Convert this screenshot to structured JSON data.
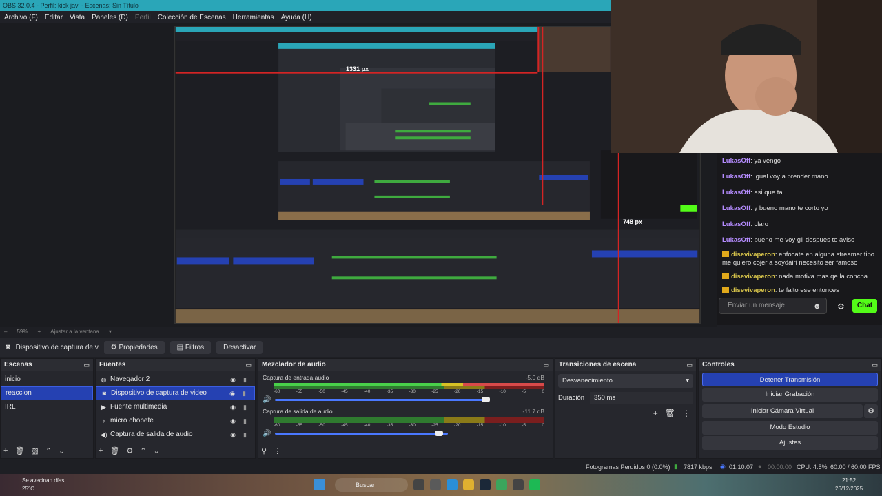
{
  "window_title": "OBS 32.0.4 - Perfil: kick javi - Escenas: Sin Título",
  "menu": [
    "Archivo (F)",
    "Editar",
    "Vista",
    "Paneles (D)",
    "Perfil",
    "Colección de Escenas",
    "Herramientas",
    "Ayuda (H)"
  ],
  "preview": {
    "measure_width": "1331 px",
    "measure_height": "748 px"
  },
  "chat": {
    "messages": [
      {
        "user": "LukasOff",
        "text": "ya vengo",
        "style": "u1"
      },
      {
        "user": "LukasOff",
        "text": "igual voy a prender mano",
        "style": "u1"
      },
      {
        "user": "LukasOff",
        "text": "asi que ta",
        "style": "u1"
      },
      {
        "user": "LukasOff",
        "text": "y bueno mano te corto yo",
        "style": "u1"
      },
      {
        "user": "LukasOff",
        "text": "claro",
        "style": "u1"
      },
      {
        "user": "LukasOff",
        "text": "bueno me voy gil despues te aviso",
        "style": "u1"
      },
      {
        "user": "disevivaperon",
        "text": "enfocate en alguna streamer tipo me quiero cojer a soydairi necesito ser famoso",
        "style": "u2"
      },
      {
        "user": "disevivaperon",
        "text": "nada motiva mas qe la concha",
        "style": "u2"
      },
      {
        "user": "disevivaperon",
        "text": "te falto ese entonces",
        "style": "u2"
      }
    ],
    "input_placeholder": "Enviar un mensaje",
    "send_label": "Chat"
  },
  "zoom": {
    "level": "59%",
    "fit": "Ajustar a la ventana"
  },
  "source_toolbar": {
    "source_name": "Dispositivo de captura de v",
    "properties": "Propiedades",
    "filters": "Filtros",
    "deactivate": "Desactivar"
  },
  "scenes": {
    "title": "Escenas",
    "items": [
      "inicio",
      "reaccion",
      "IRL"
    ],
    "selected": "reaccion"
  },
  "sources": {
    "title": "Fuentes",
    "items": [
      {
        "name": "Navegador 2",
        "icon": "globe-icon"
      },
      {
        "name": "Dispositivo de captura de video",
        "icon": "camera-icon"
      },
      {
        "name": "Fuente multimedia",
        "icon": "play-icon"
      },
      {
        "name": "micro chopete",
        "icon": "mic-icon"
      },
      {
        "name": "Captura de salida de audio",
        "icon": "speaker-icon"
      }
    ]
  },
  "mixer": {
    "title": "Mezclador de audio",
    "channels": [
      {
        "name": "Captura de entrada audio",
        "db": "-5.0 dB",
        "level": 0.79
      },
      {
        "name": "Captura de salida de audio",
        "db": "-11.7 dB",
        "level": 0.61
      }
    ],
    "ticks": [
      "-60",
      "-55",
      "-50",
      "-45",
      "-40",
      "-35",
      "-30",
      "-25",
      "-20",
      "-15",
      "-10",
      "-5",
      "0"
    ]
  },
  "transitions": {
    "title": "Transiciones de escena",
    "selected": "Desvanecimiento",
    "duration_label": "Duración",
    "duration_value": "350 ms"
  },
  "controls": {
    "title": "Controles",
    "buttons": [
      "Detener Transmisión",
      "Iniciar Grabación",
      "Iniciar Cámara Virtual",
      "Modo Estudio",
      "Ajustes"
    ]
  },
  "status": {
    "dropped": "Fotogramas Perdidos 0 (0.0%)",
    "bitrate": "7817 kbps",
    "stream_time": "01:10:07",
    "rec_time": "00:00:00",
    "cpu": "CPU: 4.5%",
    "fps": "60.00 / 60.00 FPS"
  },
  "taskbar": {
    "weather_title": "Se avecinan días...",
    "weather_temp": "25°C",
    "search": "Buscar",
    "time": "21:52",
    "date": "26/12/2025"
  }
}
